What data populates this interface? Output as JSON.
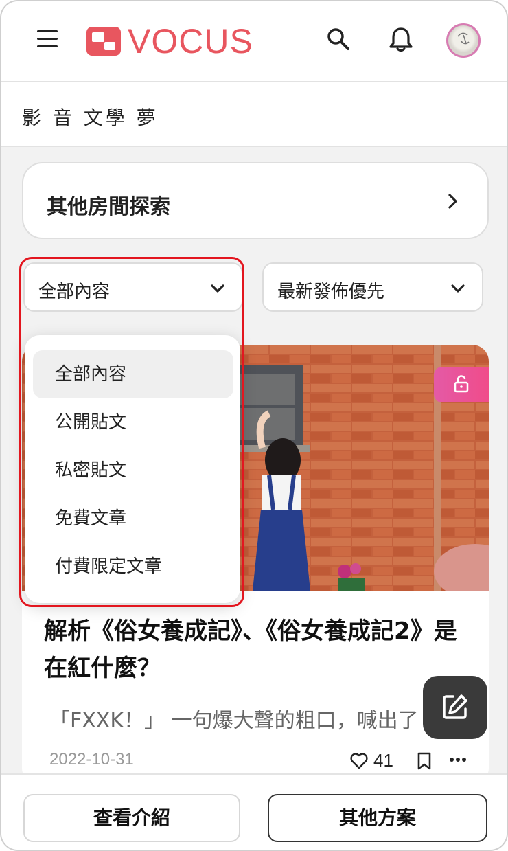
{
  "header": {
    "logo_text": "VOCUS",
    "brand_color": "#e8565f",
    "menu_icon": "hamburger-icon",
    "search_icon": "search-icon",
    "notification_icon": "bell-icon"
  },
  "room": {
    "name": "影 音 文學 夢"
  },
  "explore": {
    "label": "其他房間探索"
  },
  "filters": {
    "content_filter": "全部內容",
    "sort": "最新發佈優先"
  },
  "dropdown": {
    "items": [
      {
        "label": "全部內容",
        "selected": true
      },
      {
        "label": "公開貼文",
        "selected": false
      },
      {
        "label": "私密貼文",
        "selected": false
      },
      {
        "label": "免費文章",
        "selected": false
      },
      {
        "label": "付費限定文章",
        "selected": false
      }
    ]
  },
  "article": {
    "title": "解析《俗女養成記》、《俗女養成記2》是在紅什麼？",
    "excerpt": "「FXXK！」 一句爆大聲的粗口，喊出了",
    "date": "2022-10-31",
    "likes": "41",
    "badge_icon": "unlock-icon"
  },
  "bottom": {
    "intro_label": "查看介紹",
    "plans_label": "其他方案"
  },
  "colors": {
    "highlight_outline": "#e3161f",
    "badge_pink": "#ec4f96",
    "fab_dark": "#3a3a3a"
  }
}
